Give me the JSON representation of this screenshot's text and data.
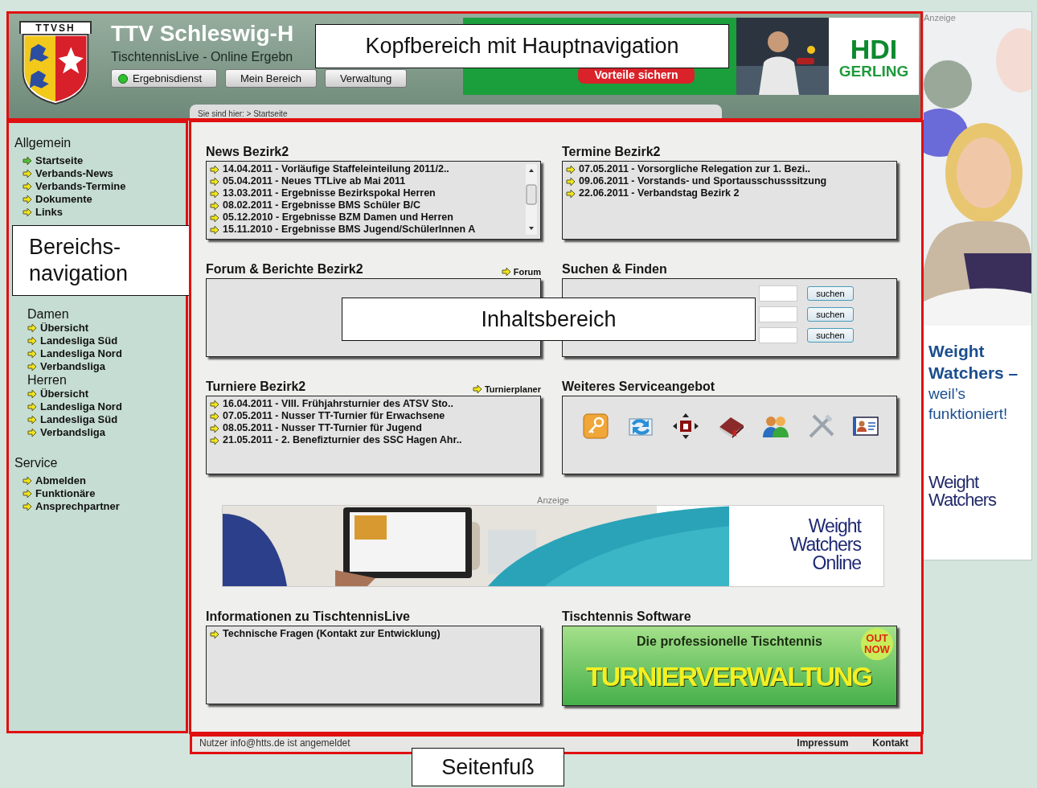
{
  "header": {
    "logo": "TTVSH",
    "title": "TTV Schleswig-H",
    "subtitle": "TischtennisLive - Online Ergebn",
    "nav": [
      {
        "label": "Ergebnisdienst",
        "selected": true
      },
      {
        "label": "Mein Bereich",
        "selected": false
      },
      {
        "label": "Verwaltung",
        "selected": false
      }
    ],
    "ad": {
      "button": "Vorteile sichern",
      "brand": [
        "HDI",
        "GERLING"
      ]
    },
    "breadcrumb": "Sie sind hier: > Startseite"
  },
  "sidebar": {
    "sections": [
      {
        "title": "Allgemein",
        "items": [
          {
            "label": "Startseite",
            "selected": true
          },
          {
            "label": "Verbands-News",
            "selected": false
          },
          {
            "label": "Verbands-Termine",
            "selected": false
          },
          {
            "label": "Dokumente",
            "selected": false
          },
          {
            "label": "Links",
            "selected": false
          }
        ]
      },
      {
        "groups": [
          {
            "title": "Damen",
            "items": [
              {
                "label": "Übersicht",
                "selected": false
              },
              {
                "label": "Landesliga Süd",
                "selected": false
              },
              {
                "label": "Landesliga Nord",
                "selected": false
              },
              {
                "label": "Verbandsliga",
                "selected": false
              }
            ]
          },
          {
            "title": "Herren",
            "items": [
              {
                "label": "Übersicht",
                "selected": false
              },
              {
                "label": "Landesliga Nord",
                "selected": false
              },
              {
                "label": "Landesliga Süd",
                "selected": false
              },
              {
                "label": "Verbandsliga",
                "selected": false
              }
            ]
          }
        ]
      },
      {
        "title": "Service",
        "items": [
          {
            "label": "Abmelden",
            "selected": false
          },
          {
            "label": "Funktionäre",
            "selected": false
          },
          {
            "label": "Ansprechpartner",
            "selected": false
          }
        ]
      }
    ]
  },
  "content": {
    "panels": [
      {
        "kind": "list",
        "title": "News Bezirk2",
        "scrollable": true,
        "items": [
          "14.04.2011 - Vorläufige Staffeleinteilung 2011/2..",
          "05.04.2011 - Neues TTLive ab Mai 2011",
          "13.03.2011 - Ergebnisse Bezirkspokal Herren",
          "08.02.2011 - Ergebnisse BMS Schüler B/C",
          "05.12.2010 - Ergebnisse BZM Damen und Herren",
          "15.11.2010 - Ergebnisse BMS Jugend/SchülerInnen A"
        ]
      },
      {
        "kind": "list",
        "title": "Termine Bezirk2",
        "items": [
          "07.05.2011 - Vorsorgliche Relegation zur 1. Bezi..",
          "09.06.2011 - Vorstands- und Sportausschusssitzung",
          "22.06.2011 - Verbandstag Bezirk 2"
        ]
      },
      {
        "kind": "empty",
        "title": "Forum & Berichte Bezirk2",
        "link": "Forum"
      },
      {
        "kind": "search",
        "title": "Suchen & Finden",
        "rows": [
          {
            "button": "suchen"
          },
          {
            "button": "suchen"
          },
          {
            "button": "suchen"
          }
        ]
      },
      {
        "kind": "list",
        "title": "Turniere Bezirk2",
        "link": "Turnierplaner",
        "items": [
          "16.04.2011 - VIII. Frühjahrsturnier des ATSV Sto..",
          "07.05.2011 - Nusser TT-Turnier für Erwachsene",
          "08.05.2011 - Nusser TT-Turnier für Jugend",
          "21.05.2011 - 2. Benefizturnier des SSC Hagen Ahr.."
        ]
      },
      {
        "kind": "icons",
        "title": "Weiteres Serviceangebot"
      },
      {
        "kind": "ad",
        "label": "Anzeige",
        "logo": [
          "Weight",
          "Watchers",
          "Online"
        ]
      },
      {
        "kind": "list",
        "title": "Informationen zu TischtennisLive",
        "items": [
          "Technische Fragen (Kontakt zur Entwicklung)"
        ]
      },
      {
        "kind": "promo",
        "title": "Tischtennis Software",
        "line": "Die professionelle Tischtennis",
        "headline": "TURNIERVERWALTUNG",
        "badge": "OUT NOW"
      }
    ]
  },
  "footer": {
    "status": "Nutzer info@htts.de ist angemeldet",
    "links": [
      "Impressum",
      "Kontakt"
    ]
  },
  "side_ad": {
    "label": "Anzeige",
    "headline": "Weight Watchers –",
    "tagline": "weil’s funktioniert!",
    "logo": [
      "Weight",
      "Watchers"
    ]
  },
  "annotations": [
    {
      "label": "Kopfbereich mit Hauptnavigation"
    },
    {
      "label": "Bereichs-\nnavigation"
    },
    {
      "label": "Inhaltsbereich"
    },
    {
      "label": "Seitenfuß"
    }
  ]
}
